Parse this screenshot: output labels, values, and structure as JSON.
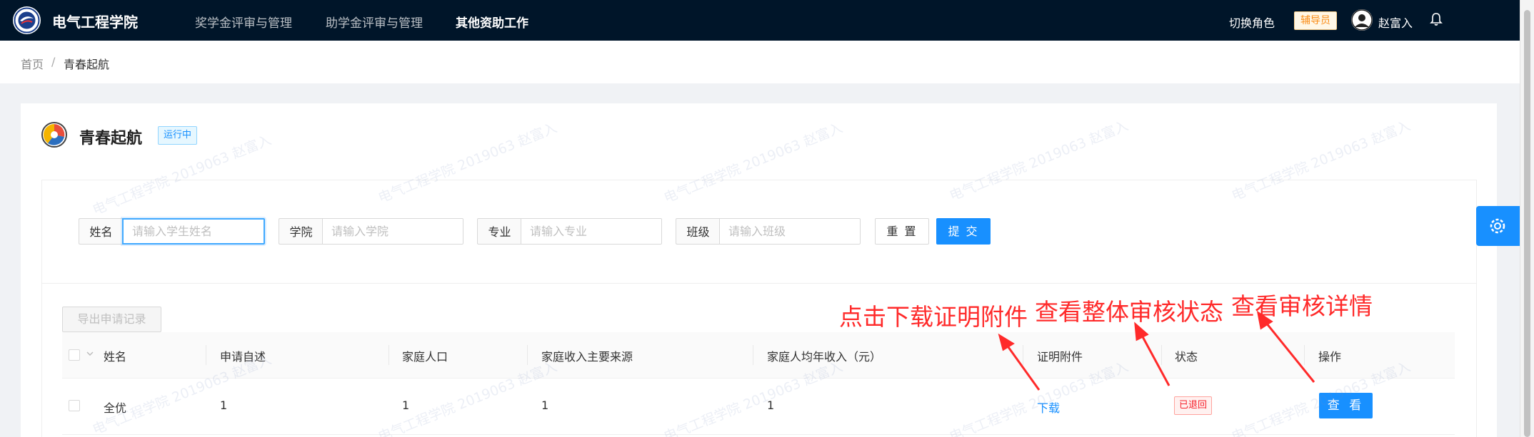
{
  "header": {
    "app_title": "电气工程学院",
    "nav": [
      {
        "label": "奖学金评审与管理",
        "active": false
      },
      {
        "label": "助学金评审与管理",
        "active": false
      },
      {
        "label": "其他资助工作",
        "active": true
      }
    ],
    "switch_role": "切换角色",
    "role_badge": "辅导员",
    "user_name": "赵富入"
  },
  "breadcrumb": {
    "home": "首页",
    "separator": "/",
    "current": "青春起航"
  },
  "page": {
    "title": "青春起航",
    "status": "运行中"
  },
  "filters": [
    {
      "label": "姓名",
      "placeholder": "请输入学生姓名"
    },
    {
      "label": "学院",
      "placeholder": "请输入学院"
    },
    {
      "label": "专业",
      "placeholder": "请输入专业"
    },
    {
      "label": "班级",
      "placeholder": "请输入班级"
    }
  ],
  "buttons": {
    "reset": "重 置",
    "submit": "提 交",
    "export": "导出申请记录"
  },
  "table": {
    "columns": [
      "姓名",
      "申请自述",
      "家庭人口",
      "家庭收入主要来源",
      "家庭人均年收入（元）",
      "证明附件",
      "状态",
      "操作"
    ],
    "rows": [
      {
        "name": "全优",
        "statement": "1",
        "family_size": "1",
        "income_source": "1",
        "per_capita_income": "1",
        "attachment": "下载",
        "status": "已退回",
        "action": "查 看"
      }
    ]
  },
  "annotations": {
    "download": "点击下载证明附件",
    "status": "查看整体审核状态",
    "detail": "查看审核详情"
  },
  "watermark": "电气工程学院 2019063 赵富入",
  "colors": {
    "nav_bg": "#001529",
    "primary": "#1890ff",
    "annotation": "#ff2a2a",
    "danger": "#f5222d",
    "warning": "#fa8c16"
  },
  "icons": [
    "college-logo-icon",
    "avatar-icon",
    "bell-icon",
    "page-logo-icon",
    "chevron-down-icon",
    "gear-icon"
  ]
}
